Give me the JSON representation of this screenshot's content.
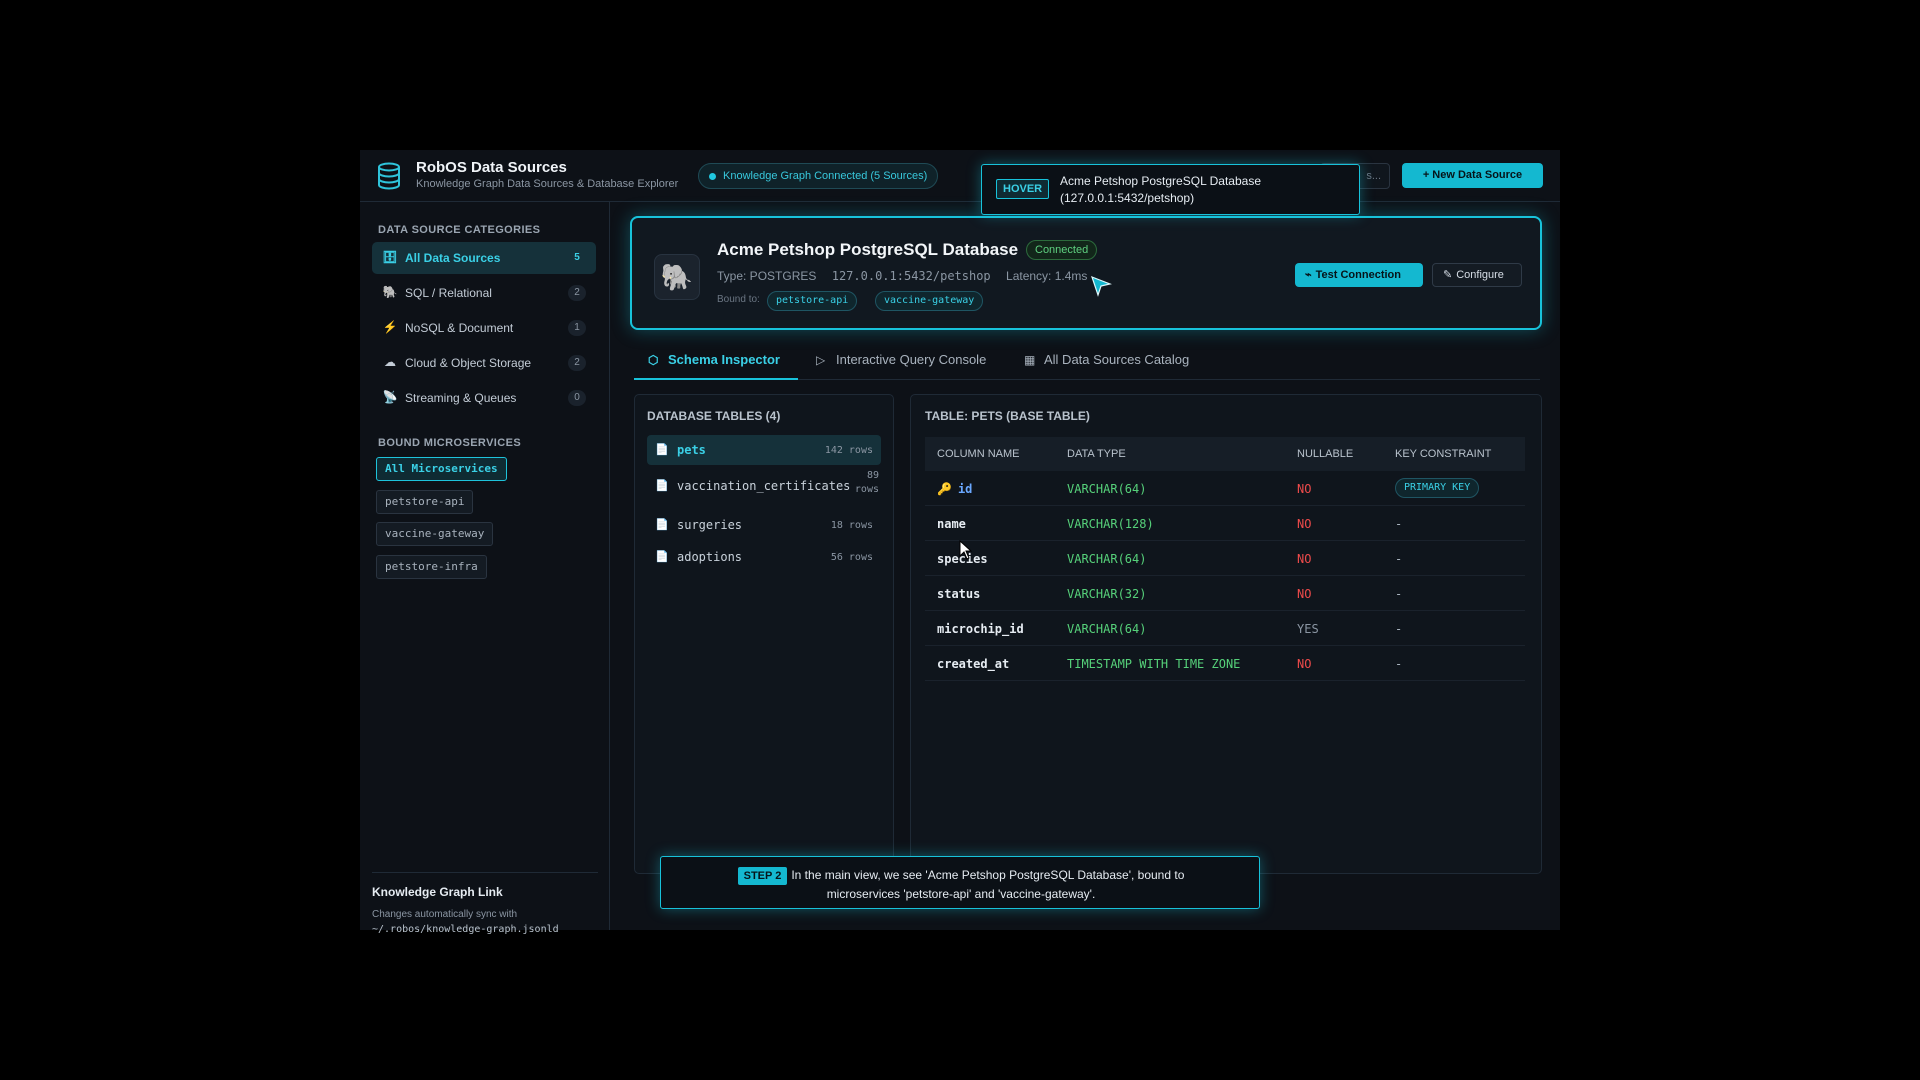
{
  "header": {
    "title": "RobOS Data Sources",
    "subtitle": "Knowledge Graph Data Sources & Database Explorer",
    "kg_status": "Knowledge Graph Connected (5 Sources)",
    "search_stub": "s...",
    "new_source_label": "+ New Data Source"
  },
  "sidebar": {
    "categories_heading": "DATA SOURCE CATEGORIES",
    "categories": [
      {
        "label": "All Data Sources",
        "count": "5",
        "icon": "database-icon"
      },
      {
        "label": "SQL / Relational",
        "count": "2",
        "icon": "elephant-icon"
      },
      {
        "label": "NoSQL & Document",
        "count": "1",
        "icon": "lightning-icon"
      },
      {
        "label": "Cloud & Object Storage",
        "count": "2",
        "icon": "cloud-icon"
      },
      {
        "label": "Streaming & Queues",
        "count": "0",
        "icon": "satellite-icon"
      }
    ],
    "microservices_heading": "BOUND MICROSERVICES",
    "microservices": [
      "All Microservices",
      "petstore-api",
      "vaccine-gateway",
      "petstore-infra"
    ],
    "kg_link_title": "Knowledge Graph Link",
    "kg_link_text": "Changes automatically sync with",
    "kg_link_path": "~/.robos/knowledge-graph.jsonld"
  },
  "datasource": {
    "name": "Acme Petshop PostgreSQL Database",
    "status": "Connected",
    "type": "Type: POSTGRES",
    "address": "127.0.0.1:5432/petshop",
    "latency": "Latency: 1.4ms",
    "bound_label": "Bound to:",
    "bound": [
      "petstore-api",
      "vaccine-gateway"
    ],
    "test_label": "Test Connection",
    "configure_label": "Configure"
  },
  "tabs": [
    "Schema Inspector",
    "Interactive Query Console",
    "All Data Sources Catalog"
  ],
  "tables": {
    "title": "DATABASE TABLES (4)",
    "items": [
      {
        "name": "pets",
        "rows": "142 rows"
      },
      {
        "name": "vaccination_certificates",
        "rows": "89 rows"
      },
      {
        "name": "surgeries",
        "rows": "18 rows"
      },
      {
        "name": "adoptions",
        "rows": "56 rows"
      }
    ]
  },
  "schema": {
    "title": "TABLE: PETS (BASE TABLE)",
    "headers": [
      "COLUMN NAME",
      "DATA TYPE",
      "NULLABLE",
      "KEY CONSTRAINT"
    ],
    "rows": [
      {
        "name": "id",
        "type": "VARCHAR(64)",
        "nullable": "NO",
        "key": "PRIMARY KEY"
      },
      {
        "name": "name",
        "type": "VARCHAR(128)",
        "nullable": "NO",
        "key": "-"
      },
      {
        "name": "species",
        "type": "VARCHAR(64)",
        "nullable": "NO",
        "key": "-"
      },
      {
        "name": "status",
        "type": "VARCHAR(32)",
        "nullable": "NO",
        "key": "-"
      },
      {
        "name": "microchip_id",
        "type": "VARCHAR(64)",
        "nullable": "YES",
        "key": "-"
      },
      {
        "name": "created_at",
        "type": "TIMESTAMP WITH TIME ZONE",
        "nullable": "NO",
        "key": "-"
      }
    ]
  },
  "hover": {
    "tag": "HOVER",
    "text": "Acme Petshop PostgreSQL Database (127.0.0.1:5432/petshop)"
  },
  "step": {
    "tag": "STEP 2",
    "text": "In the main view, we see 'Acme Petshop PostgreSQL Database', bound to microservices 'petstore-api' and 'vaccine-gateway'."
  },
  "colors": {
    "accent": "#18c2da",
    "background": "#0d1117",
    "success": "#5fd080",
    "danger": "#ef4b4b",
    "type_green": "#56d17a"
  }
}
